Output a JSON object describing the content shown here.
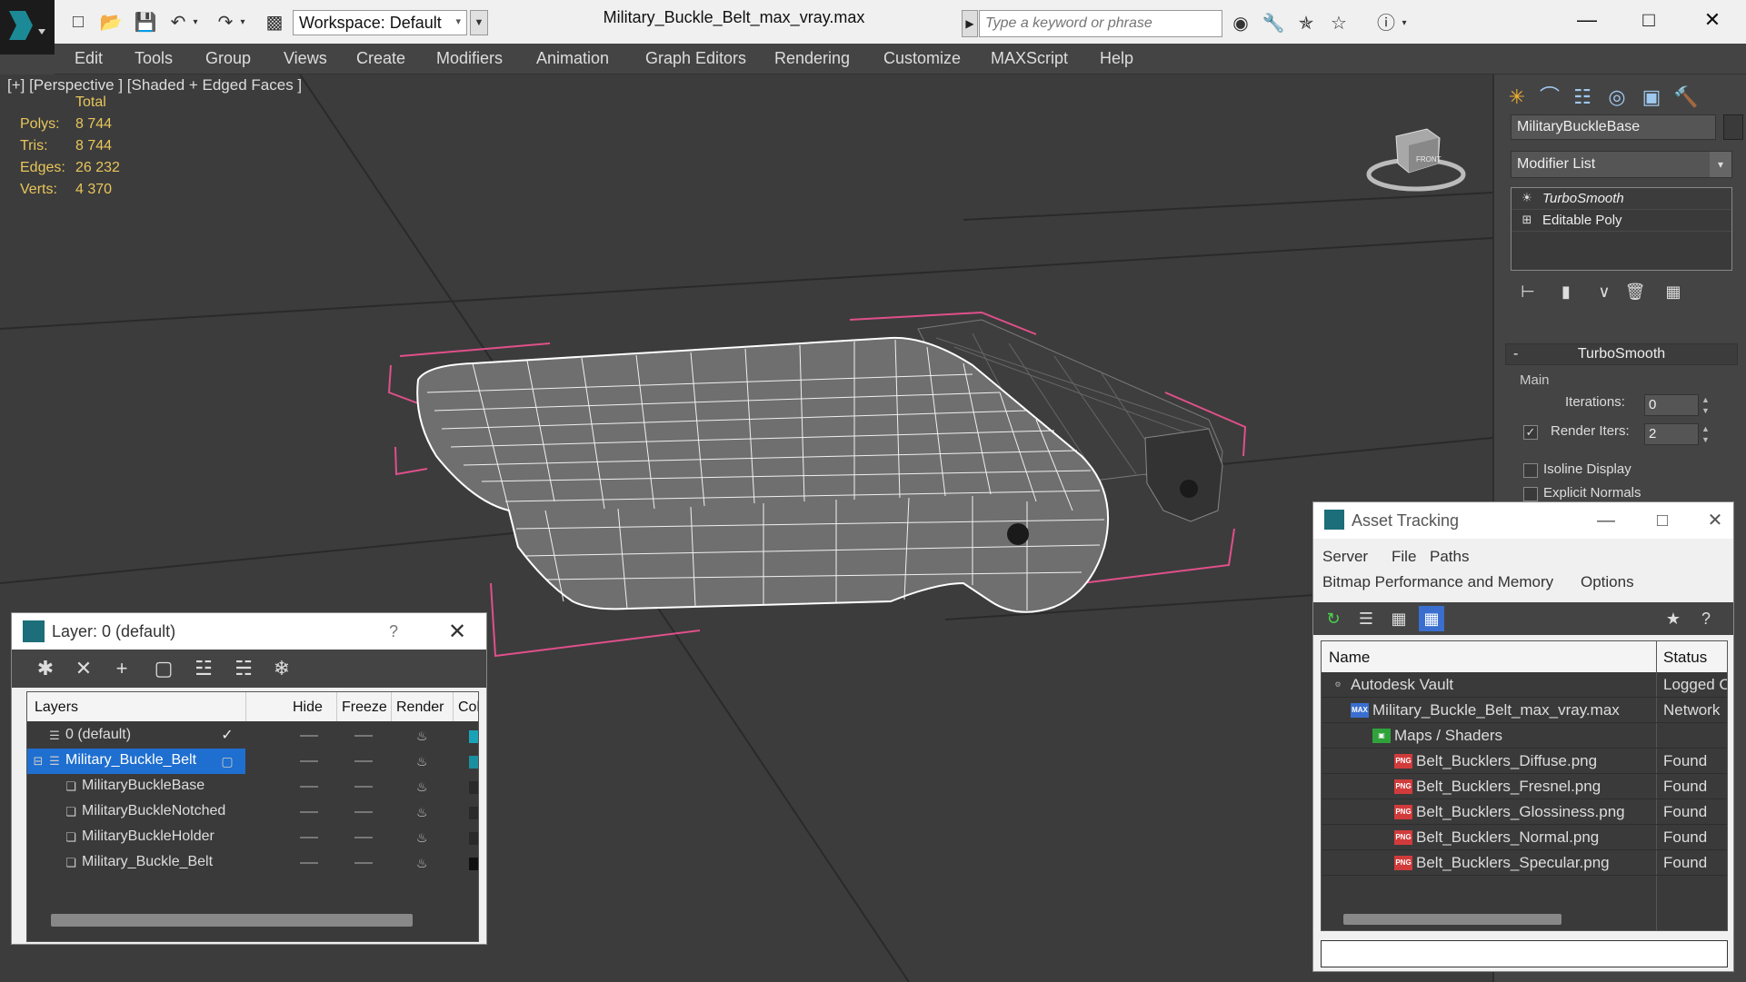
{
  "app": {
    "window_title": "Military_Buckle_Belt_max_vray.max",
    "workspace": "Workspace: Default",
    "search_placeholder": "Type a keyword or phrase"
  },
  "menu": [
    "Edit",
    "Tools",
    "Group",
    "Views",
    "Create",
    "Modifiers",
    "Animation",
    "Graph Editors",
    "Rendering",
    "Customize",
    "MAXScript",
    "Help"
  ],
  "viewport": {
    "label": "[+] [Perspective ] [Shaded + Edged Faces ]",
    "stats_header": "Total",
    "stats": [
      {
        "name": "Polys:",
        "value": "8 744"
      },
      {
        "name": "Tris:",
        "value": "8 744"
      },
      {
        "name": "Edges:",
        "value": "26 232"
      },
      {
        "name": "Verts:",
        "value": "4 370"
      }
    ],
    "viewcube_label": "FRONT"
  },
  "command_panel": {
    "object_name": "MilitaryBuckleBase",
    "modifier_list": "Modifier List",
    "stack": [
      {
        "label": "TurboSmooth",
        "selected": true
      },
      {
        "label": "Editable Poly",
        "selected": false
      }
    ],
    "rollout_title": "TurboSmooth",
    "main_label": "Main",
    "iterations_label": "Iterations:",
    "iterations_value": "0",
    "render_iters_label": "Render Iters:",
    "render_iters_value": "2",
    "isoline_label": "Isoline Display",
    "explicit_label": "Explicit Normals"
  },
  "layer_window": {
    "title": "Layer: 0 (default)",
    "help": "?",
    "columns": [
      "Layers",
      "Hide",
      "Freeze",
      "Render",
      "Col"
    ],
    "rows": [
      {
        "name": "0 (default)",
        "type": "layer",
        "indent": 1,
        "active": true,
        "selected": false,
        "color": "#1aa3b8"
      },
      {
        "name": "Military_Buckle_Belt",
        "type": "layer",
        "indent": 1,
        "active": false,
        "selected": true,
        "color": "#1a8fa0"
      },
      {
        "name": "MilitaryBuckleBase",
        "type": "object",
        "indent": 2,
        "active": false,
        "selected": false,
        "color": "#2a2a2a"
      },
      {
        "name": "MilitaryBuckleNotched",
        "type": "object",
        "indent": 2,
        "active": false,
        "selected": false,
        "color": "#2a2a2a"
      },
      {
        "name": "MilitaryBuckleHolder",
        "type": "object",
        "indent": 2,
        "active": false,
        "selected": false,
        "color": "#2a2a2a"
      },
      {
        "name": "Military_Buckle_Belt",
        "type": "object",
        "indent": 2,
        "active": false,
        "selected": false,
        "color": "#111111"
      }
    ]
  },
  "asset_window": {
    "title": "Asset Tracking",
    "menu_row1": [
      "Server",
      "File",
      "Paths"
    ],
    "menu_row2": [
      "Bitmap Performance and Memory",
      "Options"
    ],
    "columns": [
      "Name",
      "Status"
    ],
    "rows": [
      {
        "name": "Autodesk Vault",
        "status": "Logged O",
        "indent": 1,
        "icon": "vault"
      },
      {
        "name": "Military_Buckle_Belt_max_vray.max",
        "status": "Network",
        "indent": 2,
        "icon": "max"
      },
      {
        "name": "Maps / Shaders",
        "status": "",
        "indent": 3,
        "icon": "maps"
      },
      {
        "name": "Belt_Bucklers_Diffuse.png",
        "status": "Found",
        "indent": 4,
        "icon": "png"
      },
      {
        "name": "Belt_Bucklers_Fresnel.png",
        "status": "Found",
        "indent": 4,
        "icon": "png"
      },
      {
        "name": "Belt_Bucklers_Glossiness.png",
        "status": "Found",
        "indent": 4,
        "icon": "png"
      },
      {
        "name": "Belt_Bucklers_Normal.png",
        "status": "Found",
        "indent": 4,
        "icon": "png"
      },
      {
        "name": "Belt_Bucklers_Specular.png",
        "status": "Found",
        "indent": 4,
        "icon": "png"
      }
    ]
  },
  "colors": {
    "stats_text": "#e8c65a",
    "selection_box": "#e0508a",
    "wireframe": "#ffffff",
    "layer_selected": "#1f6fd0"
  }
}
